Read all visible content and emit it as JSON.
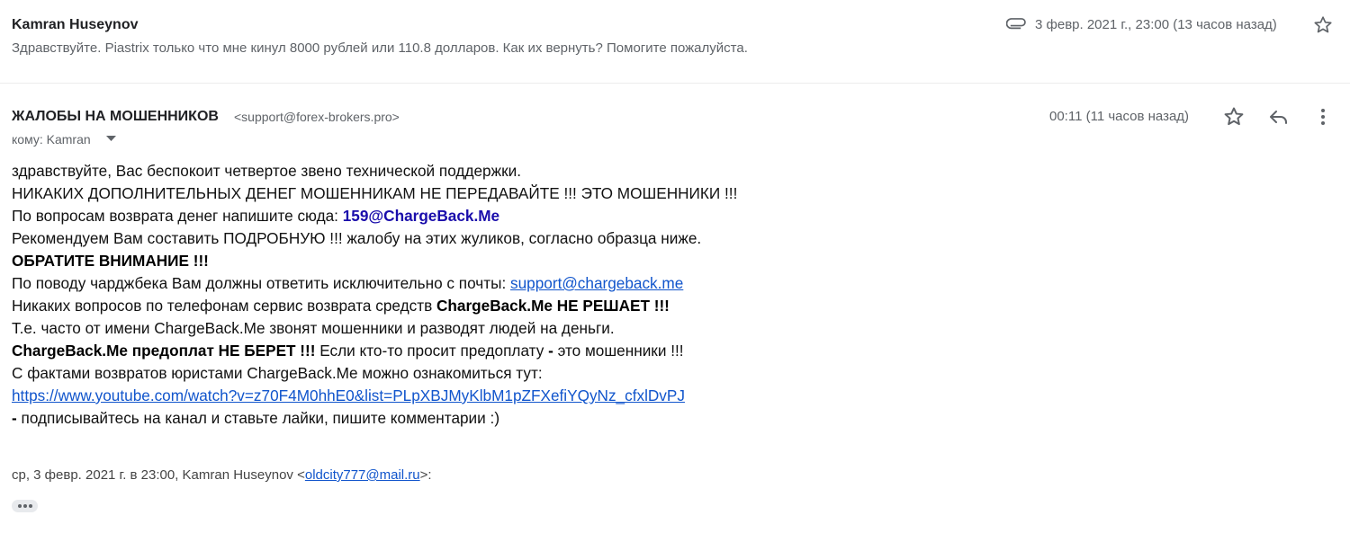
{
  "collapsed_message": {
    "sender": "Kamran Huseynov",
    "snippet": "Здравствуйте. Piastrix только что мне кинул 8000 рублей или 110.8 долларов. Как их вернуть? Помогите пожалуйста.",
    "date": "3 февр. 2021 г., 23:00 (13 часов назад)",
    "icons": [
      "attachment-icon",
      "star-icon"
    ]
  },
  "message": {
    "sender": "ЖАЛОБЫ НА МОШЕННИКОВ",
    "sender_email": "<support@forex-brokers.pro>",
    "to_label": "кому: Kamran",
    "time": "00:11 (11 часов назад)",
    "icons": [
      "star-icon",
      "reply-icon",
      "more-vert-icon",
      "chevron-down-icon"
    ],
    "body": {
      "l1": "здравствуйте, Вас беспокоит четвертое звено технической поддержки.",
      "l2": "НИКАКИХ ДОПОЛНИТЕЛЬНЫХ ДЕНЕГ МОШЕННИКАМ НЕ ПЕРЕДАВАЙТЕ !!! ЭТО МОШЕННИКИ !!!",
      "l3_text": "По вопросам возврата денег напишите сюда: ",
      "l3_email": "159@ChargeBack.Me",
      "l4": "Рекомендуем Вам составить ПОДРОБНУЮ !!! жалобу на этих жуликов, согласно образца ниже.",
      "l5": "ОБРАТИТЕ ВНИМАНИЕ !!!",
      "l6_text": "По поводу чарджбека Вам должны ответить исключительно с почты: ",
      "l6_link": "support@chargeback.me",
      "l7_text": "Никаких вопросов по телефонам сервис возврата средств ",
      "l7_bold": "ChargeBack.Me НЕ РЕШАЕТ !!!",
      "l8": "Т.е. часто от имени ChargeBack.Me звонят мошенники и разводят людей на деньги.",
      "l9_bold": "ChargeBack.Me предоплат НЕ БЕРЕТ !!!",
      "l9_text": " Если кто-то просит предоплату ",
      "l9_dash": "-",
      "l9_text2": " это мошенники !!!",
      "l10": "С фактами возвратов юристами ChargeBack.Me можно ознакомиться тут:",
      "l11_link": "https://www.youtube.com/watch?v=z70F4M0hhE0&list=PLpXBJMyKlbM1pZFXefiYQyNz_cfxlDvPJ",
      "l12_dash": " -",
      "l12_text": " подписывайтесь на канал и ставьте лайки, пишите комментарии :)"
    },
    "quote": {
      "prefix": "ср, 3 февр. 2021 г. в 23:00, Kamran Huseynov <",
      "email": "oldcity777@mail.ru",
      "suffix": ">:"
    },
    "show_trimmed_label": "•••"
  }
}
